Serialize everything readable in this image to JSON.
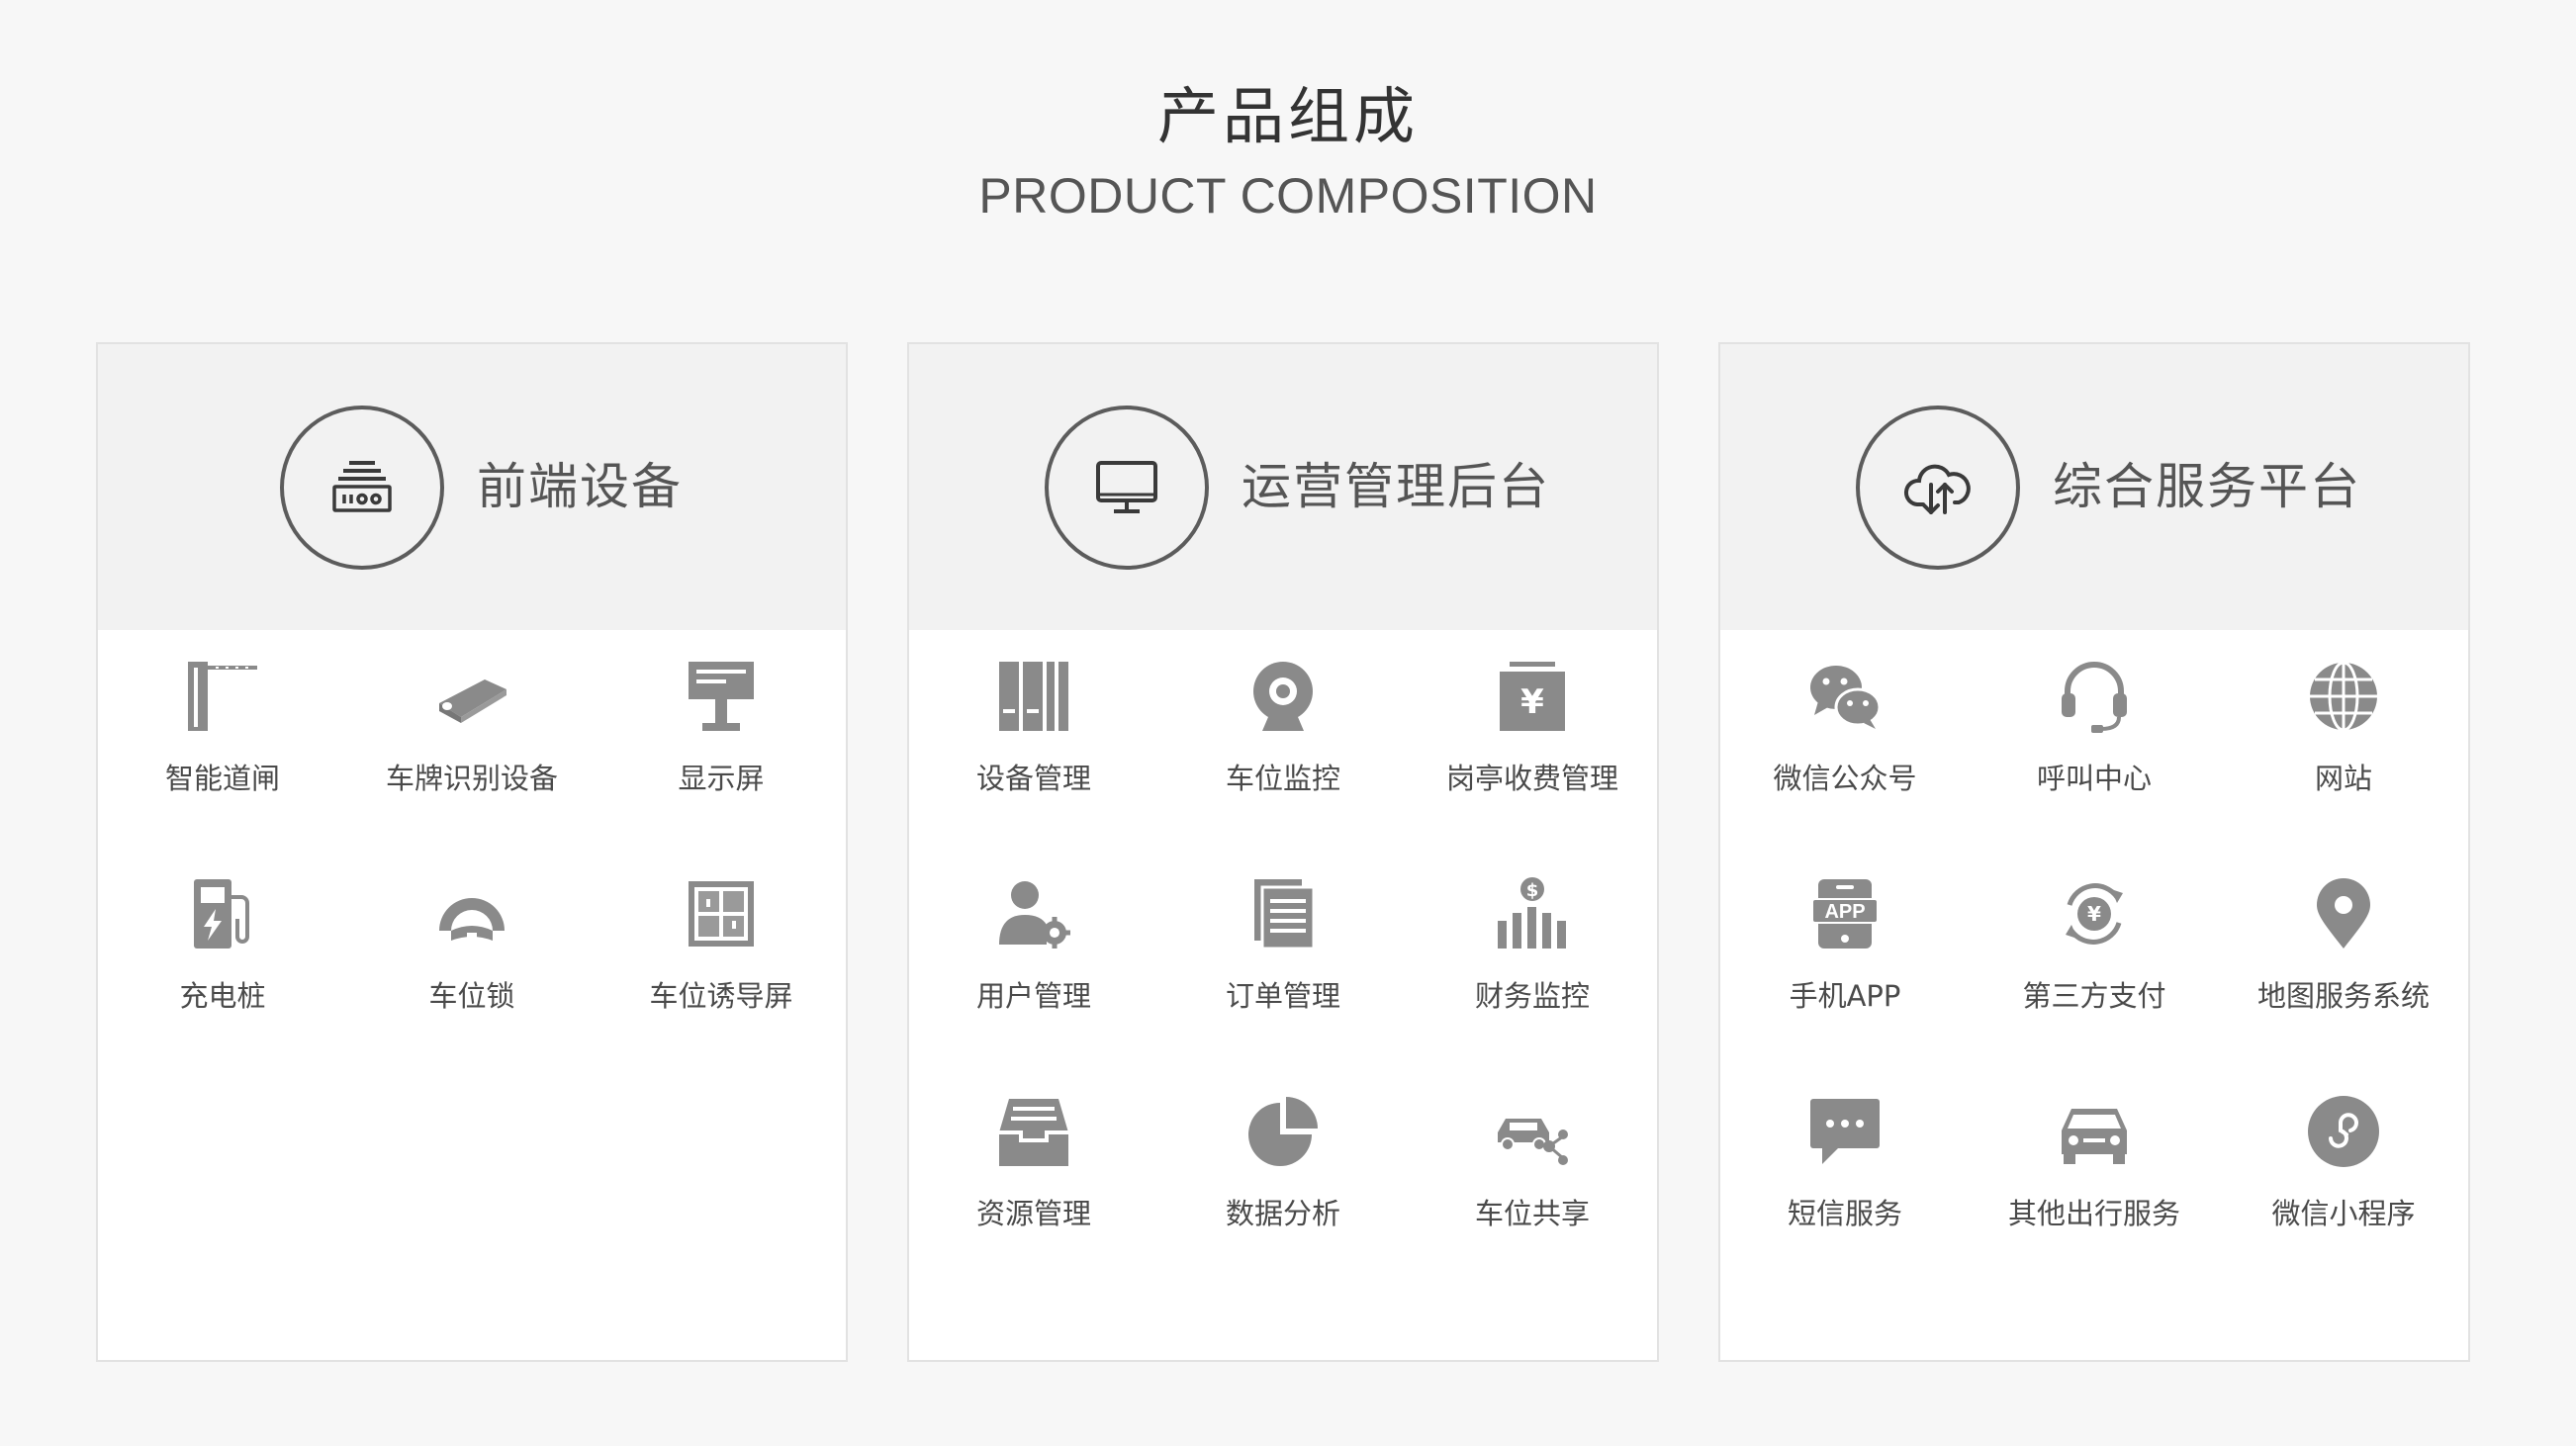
{
  "header": {
    "title_cn": "产品组成",
    "title_en": "PRODUCT COMPOSITION"
  },
  "colors": {
    "background": "#f7f7f7",
    "card_header": "#f2f2f2",
    "icon": "#8a8a8a",
    "circle_border": "#5c5c5c",
    "text": "#4a4a4a"
  },
  "cards": [
    {
      "title": "前端设备",
      "icon": "gate-machine-icon",
      "items": [
        {
          "label": "智能道闸",
          "icon": "barrier-gate-icon"
        },
        {
          "label": "车牌识别设备",
          "icon": "camera-device-icon"
        },
        {
          "label": "显示屏",
          "icon": "display-sign-icon"
        },
        {
          "label": "充电桩",
          "icon": "charging-pile-icon"
        },
        {
          "label": "车位锁",
          "icon": "parking-lock-icon"
        },
        {
          "label": "车位诱导屏",
          "icon": "guidance-screen-icon"
        }
      ]
    },
    {
      "title": "运营管理后台",
      "icon": "monitor-icon",
      "items": [
        {
          "label": "设备管理",
          "icon": "device-binders-icon"
        },
        {
          "label": "车位监控",
          "icon": "webcam-icon"
        },
        {
          "label": "岗亭收费管理",
          "icon": "cash-box-icon"
        },
        {
          "label": "用户管理",
          "icon": "user-settings-icon"
        },
        {
          "label": "订单管理",
          "icon": "order-document-icon"
        },
        {
          "label": "财务监控",
          "icon": "finance-chart-icon"
        },
        {
          "label": "资源管理",
          "icon": "inbox-tray-icon"
        },
        {
          "label": "数据分析",
          "icon": "pie-chart-icon"
        },
        {
          "label": "车位共享",
          "icon": "car-share-icon"
        }
      ]
    },
    {
      "title": "综合服务平台",
      "icon": "cloud-sync-icon",
      "items": [
        {
          "label": "微信公众号",
          "icon": "wechat-icon"
        },
        {
          "label": "呼叫中心",
          "icon": "headset-icon"
        },
        {
          "label": "网站",
          "icon": "globe-icon"
        },
        {
          "label": "手机APP",
          "icon": "mobile-app-icon"
        },
        {
          "label": "第三方支付",
          "icon": "payment-icon"
        },
        {
          "label": "地图服务系统",
          "icon": "map-pin-icon"
        },
        {
          "label": "短信服务",
          "icon": "sms-bubble-icon"
        },
        {
          "label": "其他出行服务",
          "icon": "car-front-icon"
        },
        {
          "label": "微信小程序",
          "icon": "mini-program-icon"
        }
      ]
    }
  ]
}
